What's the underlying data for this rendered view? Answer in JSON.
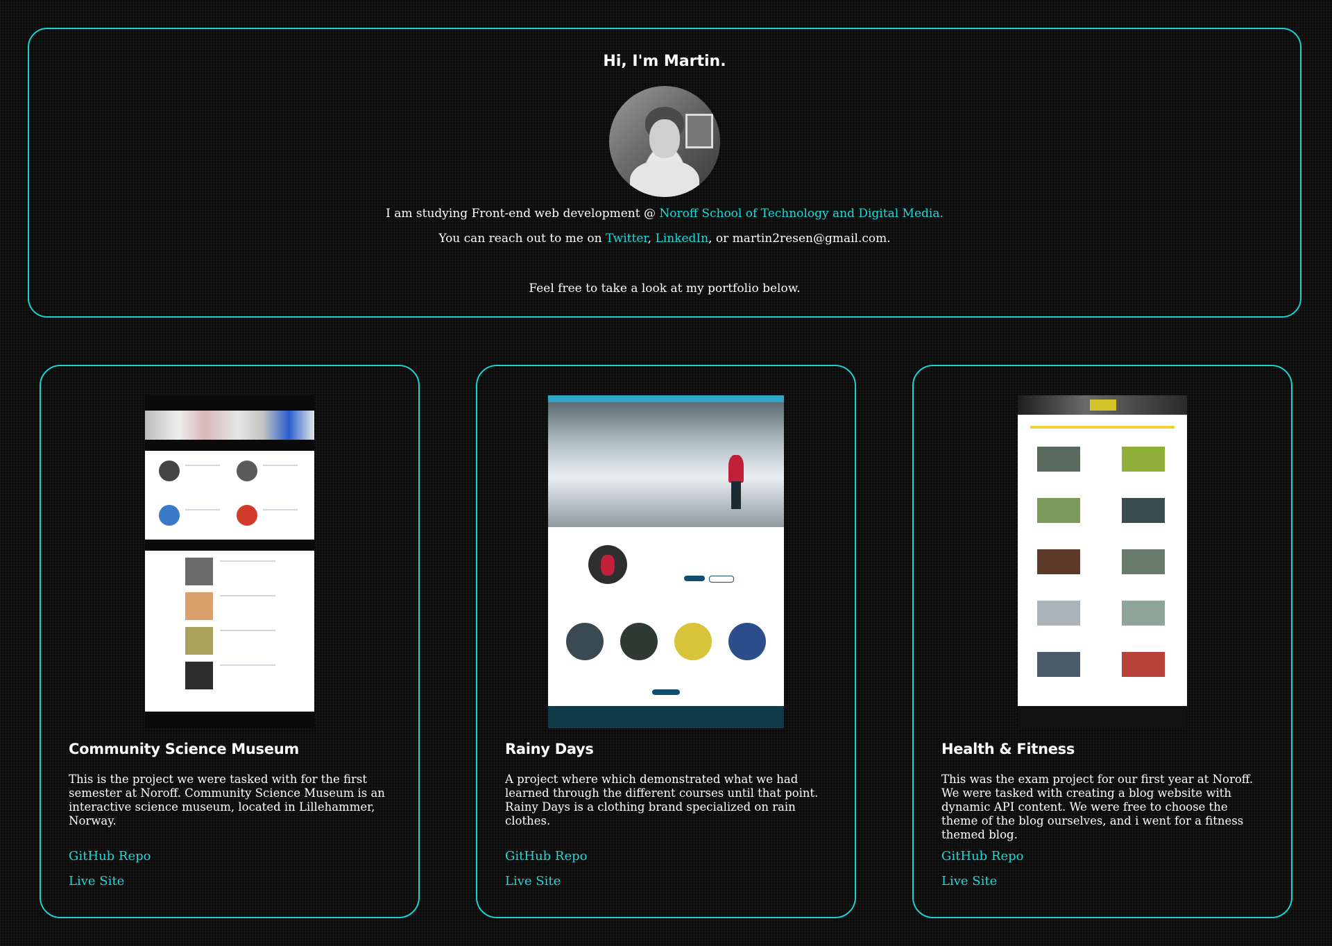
{
  "intro": {
    "greeting": "Hi, I'm Martin.",
    "study_prefix": "I am studying Front-end web development @ ",
    "school_link": "Noroff School of Technology and Digital Media.",
    "reach_prefix": "You can reach out to me on ",
    "twitter_link": "Twitter",
    "comma": ", ",
    "linkedin_link": "LinkedIn",
    "reach_suffix": ", or martin2resen@gmail.com.",
    "portfolio_note": "Feel free to take a look at my portfolio below."
  },
  "colors": {
    "accent": "#19d3d3",
    "background": "#0b0b0b",
    "text": "#ffffff"
  },
  "projects": [
    {
      "title": "Community Science Museum",
      "description": "This is the project we were tasked with for the first semester at Noroff. Community Science Museum is an interactive science museum, located in Lillehammer, Norway.",
      "repo_label": "GitHub Repo",
      "live_label": "Live Site"
    },
    {
      "title": "Rainy Days",
      "description": "A project where which demonstrated what we had learned through the different courses until that point. Rainy Days is a clothing brand specialized on rain clothes.",
      "repo_label": "GitHub Repo",
      "live_label": "Live Site"
    },
    {
      "title": "Health & Fitness",
      "description": "This was the exam project for our first year at Noroff. We were tasked with creating a blog website with dynamic API content. We were free to choose the theme of the blog ourselves, and i went for a fitness themed blog.",
      "repo_label": "GitHub Repo",
      "live_label": "Live Site"
    }
  ]
}
